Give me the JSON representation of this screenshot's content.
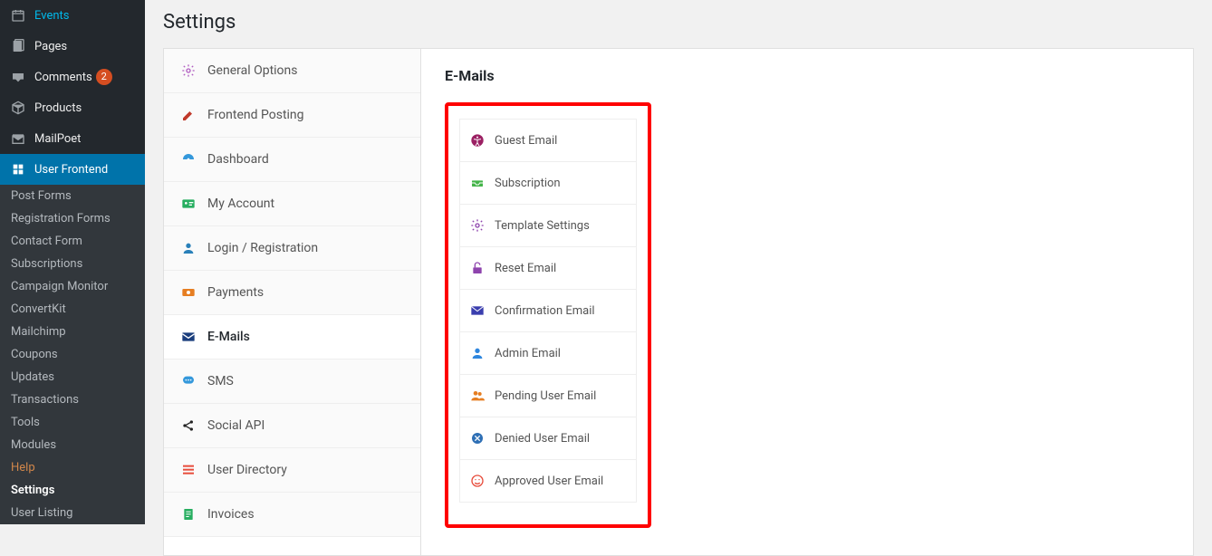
{
  "page_title": "Settings",
  "wp_menu": [
    {
      "label": "Events",
      "icon": "calendar"
    },
    {
      "label": "Pages",
      "icon": "page"
    },
    {
      "label": "Comments",
      "icon": "comment",
      "badge": "2"
    },
    {
      "label": "Products",
      "icon": "box"
    },
    {
      "label": "MailPoet",
      "icon": "mailpoet"
    },
    {
      "label": "User Frontend",
      "icon": "uf",
      "active": true
    }
  ],
  "wp_submenu": [
    {
      "label": "Post Forms"
    },
    {
      "label": "Registration Forms"
    },
    {
      "label": "Contact Form"
    },
    {
      "label": "Subscriptions"
    },
    {
      "label": "Campaign Monitor"
    },
    {
      "label": "ConvertKit"
    },
    {
      "label": "Mailchimp"
    },
    {
      "label": "Coupons"
    },
    {
      "label": "Updates"
    },
    {
      "label": "Transactions"
    },
    {
      "label": "Tools"
    },
    {
      "label": "Modules"
    },
    {
      "label": "Help",
      "variant": "help"
    },
    {
      "label": "Settings",
      "current": true
    },
    {
      "label": "User Listing"
    }
  ],
  "settings_tabs": [
    {
      "label": "General Options",
      "icon": "gear",
      "color": "#b15dc1"
    },
    {
      "label": "Frontend Posting",
      "icon": "edit",
      "color": "#c0392b"
    },
    {
      "label": "Dashboard",
      "icon": "dash",
      "color": "#3498db"
    },
    {
      "label": "My Account",
      "icon": "idcard",
      "color": "#27ae60"
    },
    {
      "label": "Login / Registration",
      "icon": "user",
      "color": "#2980b9"
    },
    {
      "label": "Payments",
      "icon": "cash",
      "color": "#e67e22"
    },
    {
      "label": "E-Mails",
      "icon": "mail",
      "color": "#1a3d7c",
      "active": true
    },
    {
      "label": "SMS",
      "icon": "sms",
      "color": "#3498db"
    },
    {
      "label": "Social API",
      "icon": "share",
      "color": "#222"
    },
    {
      "label": "User Directory",
      "icon": "list",
      "color": "#e74c3c"
    },
    {
      "label": "Invoices",
      "icon": "invoice",
      "color": "#27ae60"
    }
  ],
  "panel": {
    "title": "E-Mails",
    "email_items": [
      {
        "label": "Guest Email",
        "icon": "accessibility",
        "color": "#9b2063"
      },
      {
        "label": "Subscription",
        "icon": "inbox",
        "color": "#44b449"
      },
      {
        "label": "Template Settings",
        "icon": "gear",
        "color": "#8e44ad"
      },
      {
        "label": "Reset Email",
        "icon": "lock-open",
        "color": "#8e44ad"
      },
      {
        "label": "Confirmation Email",
        "icon": "envelope",
        "color": "#3a3eae"
      },
      {
        "label": "Admin Email",
        "icon": "user-solid",
        "color": "#2e86de"
      },
      {
        "label": "Pending User Email",
        "icon": "users",
        "color": "#e67e22"
      },
      {
        "label": "Denied User Email",
        "icon": "x-circle",
        "color": "#2e6fb5"
      },
      {
        "label": "Approved User Email",
        "icon": "smile",
        "color": "#e74c3c"
      }
    ]
  }
}
